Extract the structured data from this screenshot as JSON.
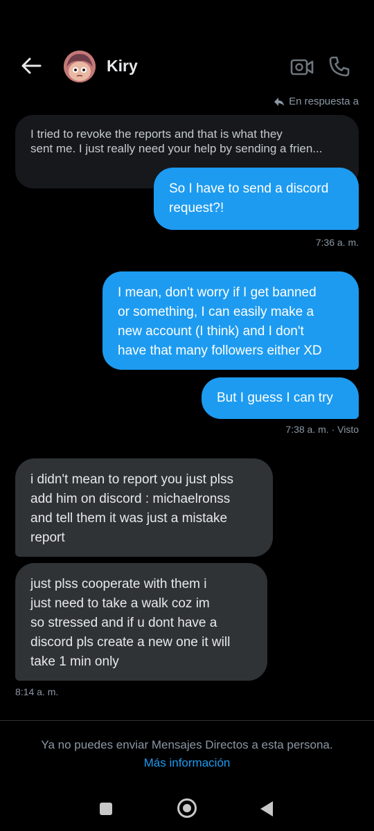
{
  "header": {
    "contact_name": "Kiry"
  },
  "thread": {
    "reply_label": "En respuesta a",
    "quoted_message": {
      "line1": "I tried to revoke the reports and that is what they",
      "line2": "sent me. I just really need your help by sending a frien..."
    },
    "messages": [
      {
        "id": "m1",
        "direction": "sent",
        "text": "So I have to send a discord\nrequest?!"
      },
      {
        "id": "t1",
        "time": "7:36 a. m."
      },
      {
        "id": "m2",
        "direction": "sent",
        "text": "I mean, don't worry if I get banned\nor something, I can easily make a\nnew account (I think) and I don't\nhave that many followers either XD"
      },
      {
        "id": "m3",
        "direction": "sent",
        "text": "But I guess I can try"
      },
      {
        "id": "t2",
        "time": "7:38 a. m. · Visto"
      },
      {
        "id": "m4",
        "direction": "received",
        "text": "i didn't mean to report you just plss\nadd him on discord : michaelronss\nand tell them it was just a mistake\nreport"
      },
      {
        "id": "m5",
        "direction": "received",
        "text": "just plss cooperate with them i\njust need to take a walk coz im\nso stressed and if u dont have a\ndiscord pls create a new one it will\ntake 1 min only"
      },
      {
        "id": "t3",
        "time": "8:14 a. m."
      }
    ]
  },
  "footer": {
    "notice": "Ya no puedes enviar Mensajes Directos a esta persona.",
    "link": "Más información"
  },
  "colors": {
    "background": "#000000",
    "sent_bubble": "#1d9bf0",
    "received_bubble": "#2f3336",
    "muted_text": "#8b98a5",
    "link": "#1d9bf0"
  },
  "icons": [
    "arrow-left-icon",
    "video-camera-icon",
    "phone-icon",
    "reply-icon",
    "nav-recents-icon",
    "nav-home-icon",
    "nav-back-icon"
  ]
}
